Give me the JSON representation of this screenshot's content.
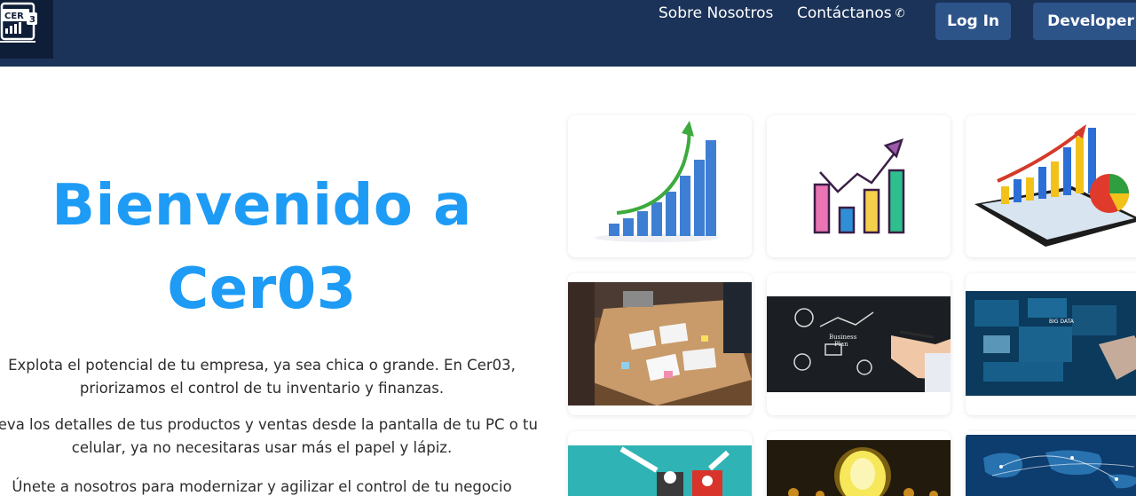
{
  "header": {
    "logo_text": "CER",
    "logo_badge": "3",
    "nav": {
      "about": "Sobre Nosotros",
      "contact": "Contáctanos"
    },
    "buttons": {
      "login": "Log In",
      "developer": "Developer"
    }
  },
  "hero": {
    "title_line1": "Bienvenido a",
    "title_line2": "Cer03",
    "paragraphs": [
      "Explota el potencial de tu empresa, ya sea chica o grande. En Cer03, priorizamos el control de tu inventario y finanzas.",
      "Lleva los detalles de tus productos y ventas desde la pantalla de tu PC o tu celular, ya no necesitaras usar más el papel y lápiz.",
      "Únete a nosotros para modernizar y agilizar el control de tu negocio"
    ]
  },
  "gallery": {
    "image_labels": {
      "bigdata": "BIG DATA",
      "plan_line1": "Business",
      "plan_line2": "Plan"
    }
  },
  "colors": {
    "header_bg": "#1b3358",
    "button_bg": "#2d5489",
    "title_blue": "#1e9bf5"
  }
}
